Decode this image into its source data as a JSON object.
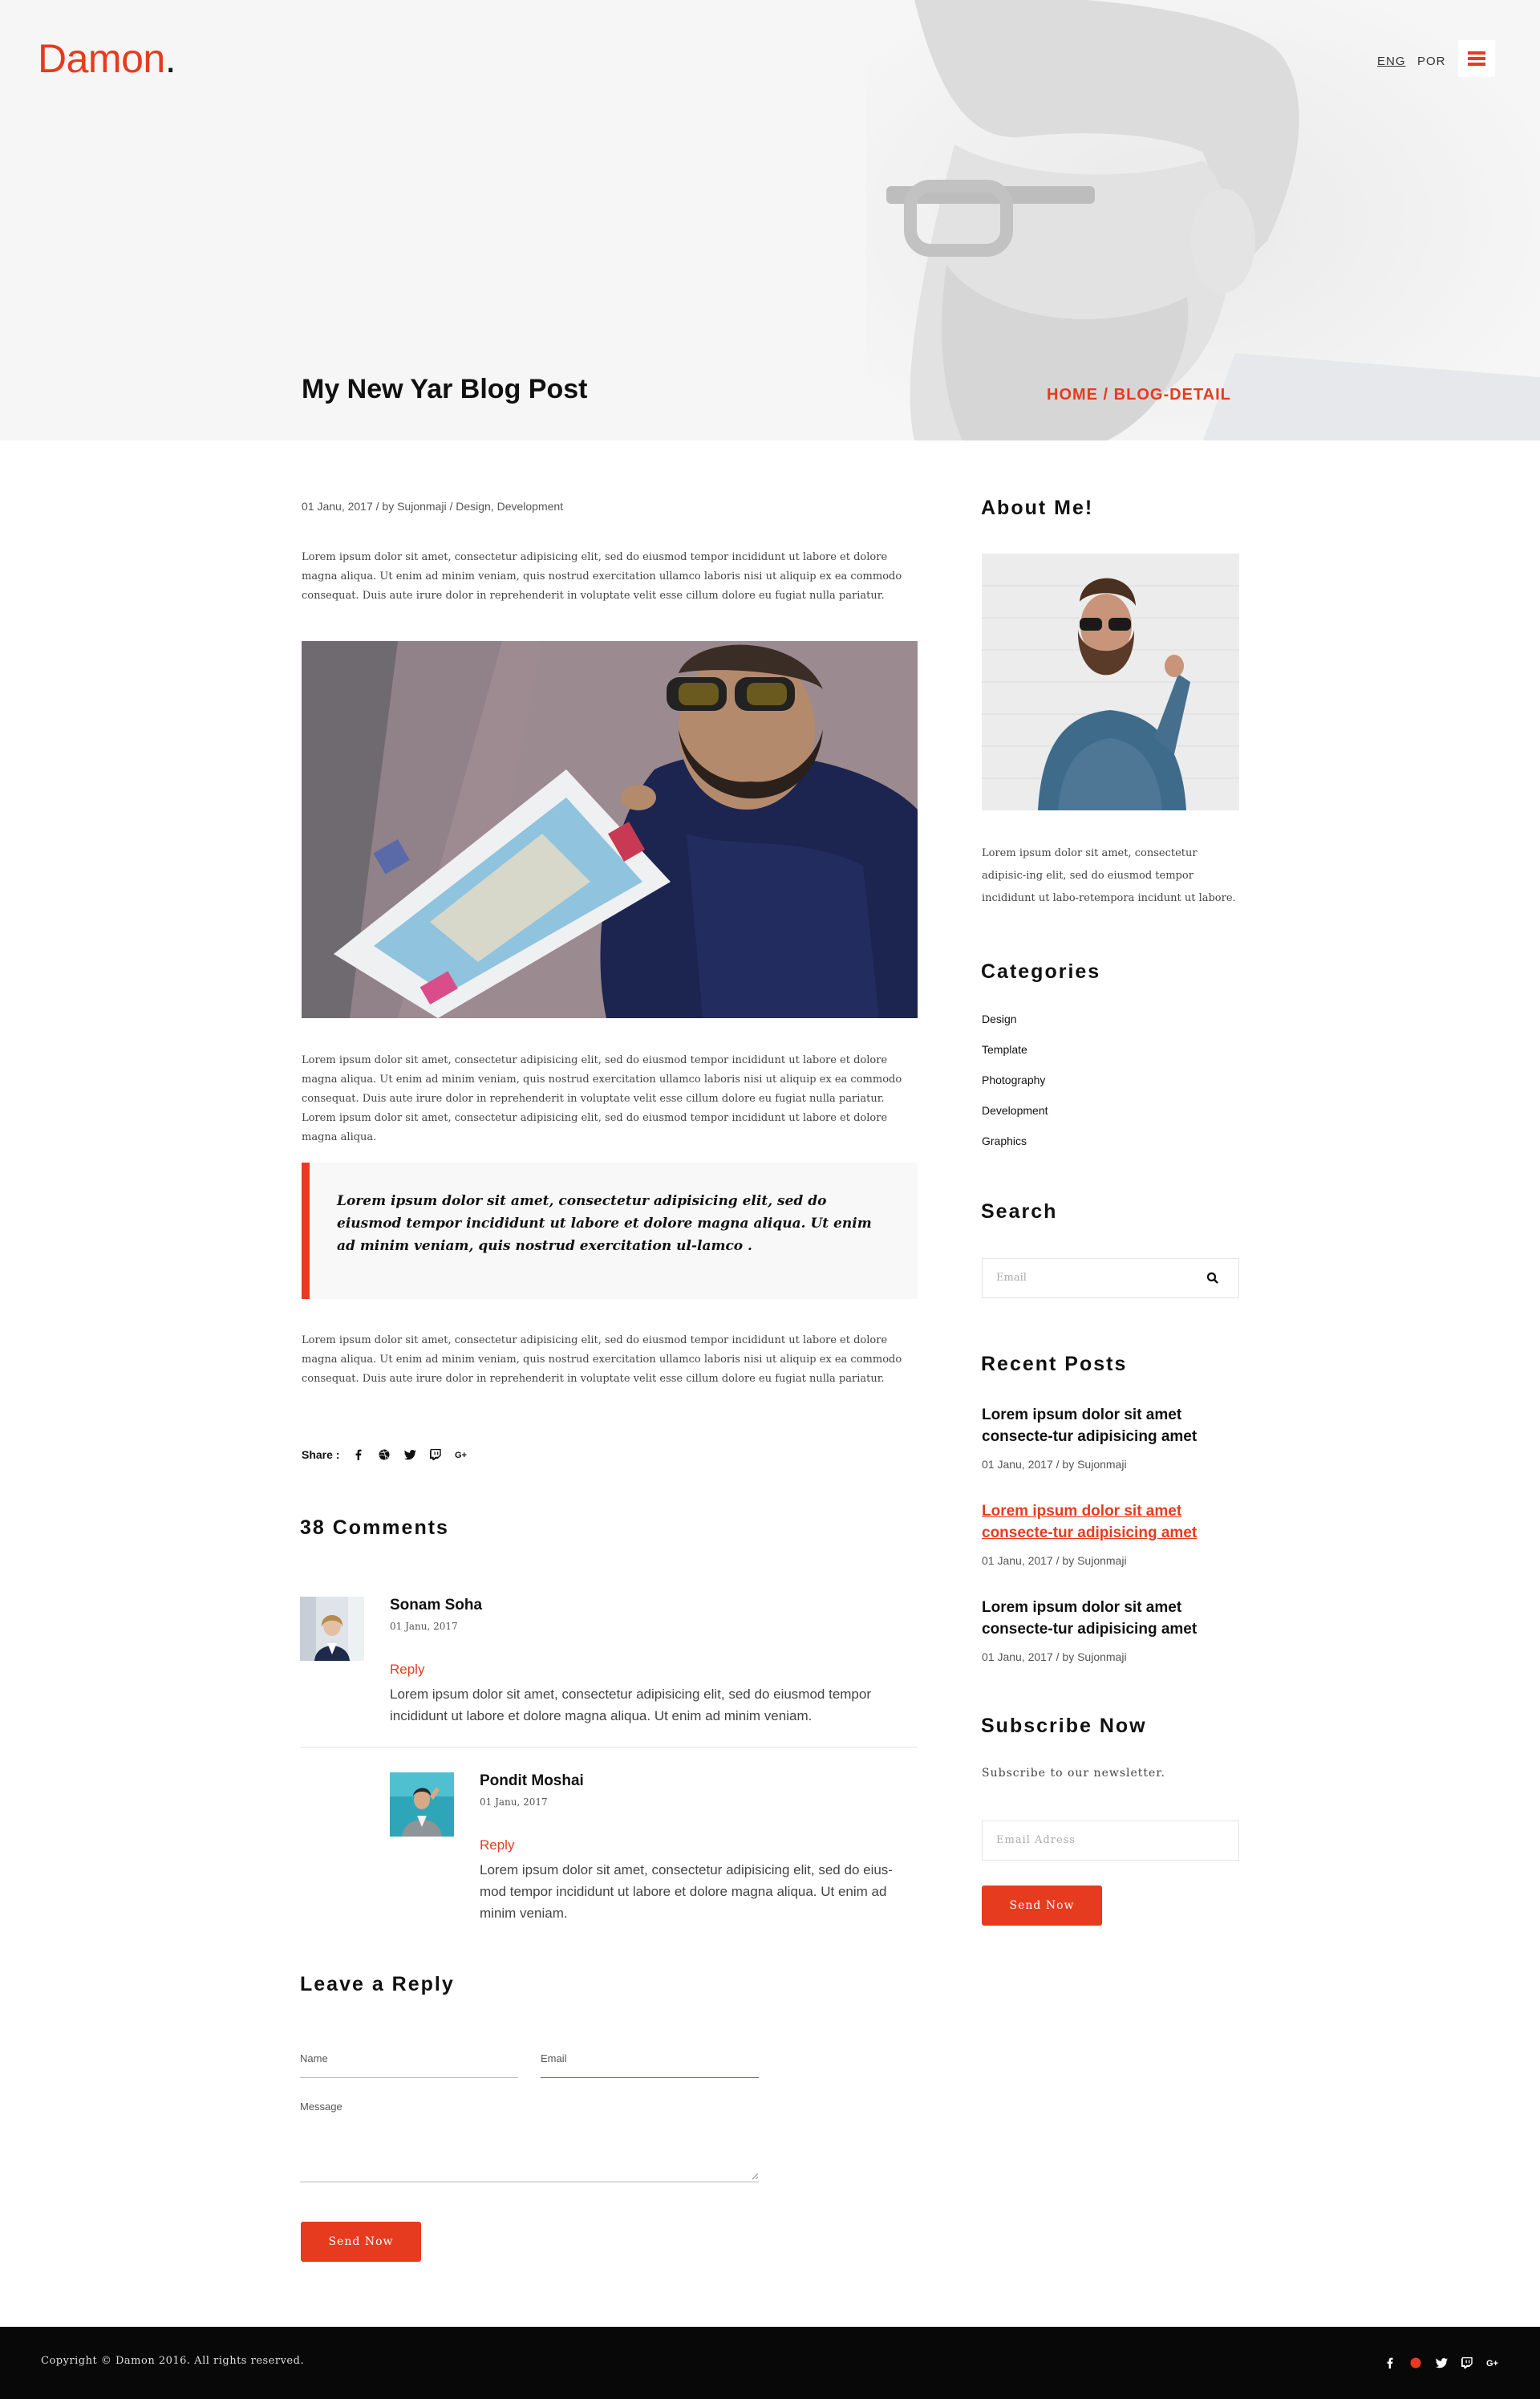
{
  "header": {
    "logo_text": "Damon",
    "logo_dot": ".",
    "lang_eng": "ENG",
    "lang_por": "POR",
    "page_title": "My New Yar Blog Post",
    "breadcrumb": "HOME / BLOG-DETAIL"
  },
  "post": {
    "meta": "01 Janu, 2017  /  by Sujonmaji  /  Design, Development",
    "intro": "Lorem ipsum dolor sit amet, consectetur adipisicing elit, sed do eiusmod tempor incididunt ut labore et dolore magna aliqua. Ut enim ad minim veniam, quis nostrud exercitation ullamco laboris nisi ut aliquip ex ea commodo consequat. Duis aute irure dolor in reprehenderit in voluptate velit esse cillum dolore eu fugiat nulla pariatur.",
    "body": "Lorem ipsum dolor sit amet, consectetur adipisicing elit, sed do eiusmod tempor incididunt ut labore et dolore magna aliqua. Ut enim ad minim veniam, quis nostrud exercitation ullamco laboris nisi ut aliquip ex ea commodo consequat. Duis aute irure dolor in reprehenderit in voluptate velit esse cillum dolore eu fugiat nulla pariatur.  Lorem ipsum dolor sit amet, consectetur adipisicing elit, sed do eiusmod tempor incididunt ut labore et dolore magna aliqua.",
    "quote": "Lorem ipsum dolor sit amet, consectetur adipisicing elit, sed do eiusmod tempor incididunt ut labore et dolore magna aliqua. Ut enim ad minim veniam, quis nostrud exercitation ul-lamco .",
    "outro": "Lorem ipsum dolor sit amet, consectetur adipisicing elit, sed do eiusmod tempor incididunt ut labore et dolore magna aliqua. Ut enim ad minim veniam, quis nostrud exercitation ullamco laboris nisi ut aliquip ex ea commodo consequat. Duis aute irure dolor in reprehenderit in voluptate velit esse cillum dolore eu fugiat nulla pariatur.",
    "share_label": "Share :",
    "share_icons": [
      "facebook-icon",
      "dribbble-icon",
      "twitter-icon",
      "twitch-icon",
      "google-plus-icon"
    ]
  },
  "comments": {
    "title": "38 Comments",
    "items": [
      {
        "name": "Sonam Soha",
        "date": "01 Janu, 2017",
        "reply": "Reply",
        "text": "Lorem ipsum dolor sit amet, consectetur adipisicing elit, sed do eiusmod tempor incididunt ut labore et dolore magna aliqua. Ut enim ad minim veniam."
      },
      {
        "name": "Pondit Moshai",
        "date": "01 Janu, 2017",
        "reply": "Reply",
        "text": "Lorem ipsum dolor sit amet, consectetur adipisicing elit, sed do eius-mod tempor incididunt ut labore et dolore magna aliqua. Ut enim ad minim veniam."
      }
    ]
  },
  "reply_form": {
    "title": "Leave a Reply",
    "name_label": "Name",
    "email_label": "Email",
    "message_label": "Message",
    "submit": "Send Now"
  },
  "sidebar": {
    "about_title": "About Me!",
    "about_text": "Lorem ipsum dolor sit amet, consectetur adipisic-ing elit, sed do eiusmod tempor incididunt ut labo-retempora incidunt ut labore.",
    "categories_title": "Categories",
    "categories": [
      "Design",
      "Template",
      "Photography",
      "Development",
      "Graphics"
    ],
    "search_title": "Search",
    "search_placeholder": "Email",
    "recent_title": "Recent Posts",
    "recent_posts": [
      {
        "title": "Lorem ipsum dolor sit amet consecte-tur adipisicing amet",
        "meta": "01 Janu, 2017  /  by Sujonmaji"
      },
      {
        "title": "Lorem ipsum dolor sit amet consecte-tur adipisicing amet",
        "meta": "01 Janu, 2017  /  by Sujonmaji"
      },
      {
        "title": "Lorem ipsum dolor sit amet consecte-tur adipisicing amet",
        "meta": "01 Janu, 2017  /  by Sujonmaji"
      }
    ],
    "subscribe_title": "Subscribe Now",
    "subscribe_text": "Subscribe to our newsletter.",
    "subscribe_placeholder": "Email Adress",
    "subscribe_button": "Send Now"
  },
  "footer": {
    "copyright": "Copyright © Damon 2016. All rights reserved.",
    "social_icons": [
      "facebook-icon",
      "dribbble-icon",
      "twitter-icon",
      "twitch-icon",
      "google-plus-icon"
    ]
  },
  "colors": {
    "accent": "#e63b1f",
    "footer_bg": "#080808",
    "hero_bg": "#f6f6f6"
  }
}
